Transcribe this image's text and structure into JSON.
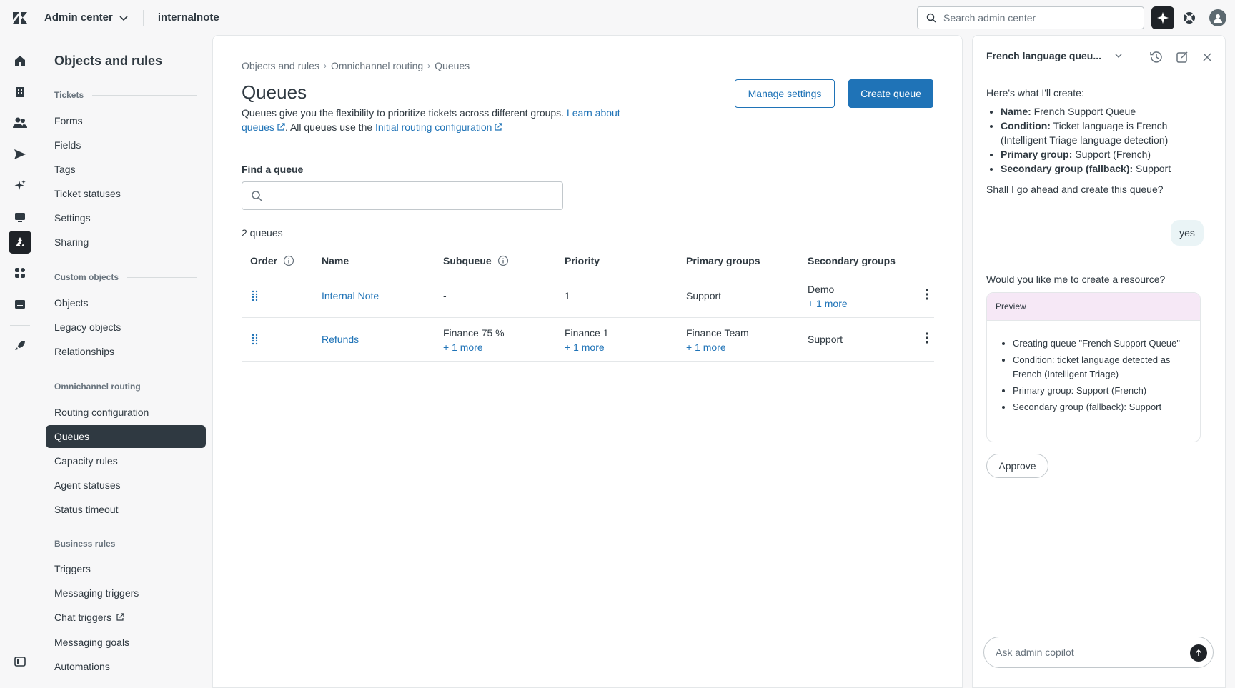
{
  "topbar": {
    "product": "Admin center",
    "account": "internalnote",
    "search_placeholder": "Search admin center"
  },
  "sidenav": {
    "title": "Objects and rules",
    "sections": [
      {
        "label": "Tickets",
        "items": [
          "Forms",
          "Fields",
          "Tags",
          "Ticket statuses",
          "Settings",
          "Sharing"
        ]
      },
      {
        "label": "Custom objects",
        "items": [
          "Objects",
          "Legacy objects",
          "Relationships"
        ]
      },
      {
        "label": "Omnichannel routing",
        "items": [
          "Routing configuration",
          "Queues",
          "Capacity rules",
          "Agent statuses",
          "Status timeout"
        ]
      },
      {
        "label": "Business rules",
        "items": [
          "Triggers",
          "Messaging triggers",
          "Chat triggers",
          "Messaging goals",
          "Automations"
        ]
      }
    ],
    "active_item": "Queues"
  },
  "main": {
    "breadcrumbs": [
      "Objects and rules",
      "Omnichannel routing",
      "Queues"
    ],
    "title": "Queues",
    "desc_text_1": "Queues give you the flexibility to prioritize tickets across different groups. ",
    "desc_link_1": "Learn about queues",
    "desc_text_2": ". All queues use the ",
    "desc_link_2": "Initial routing configuration",
    "manage_settings": "Manage settings",
    "create_queue": "Create queue",
    "find_label": "Find a queue",
    "count": "2 queues",
    "columns": [
      "Order",
      "Name",
      "Subqueue",
      "Priority",
      "Primary groups",
      "Secondary groups"
    ],
    "rows": [
      {
        "name": "Internal Note",
        "subqueue": "-",
        "subqueue_more": "",
        "priority": "1",
        "priority_more": "",
        "primary": "Support",
        "primary_more": "",
        "secondary": "Demo",
        "secondary_more": "+ 1 more"
      },
      {
        "name": "Refunds",
        "subqueue": "Finance 75 %",
        "subqueue_more": "+ 1 more",
        "priority": "Finance 1",
        "priority_more": "+ 1 more",
        "primary": "Finance Team",
        "primary_more": "+ 1 more",
        "secondary": "Support",
        "secondary_more": ""
      }
    ]
  },
  "copilot": {
    "title": "French language queu...",
    "intro": "Here's what I'll create:",
    "list": [
      {
        "key": "Name:",
        "value": " French Support Queue"
      },
      {
        "key": "Condition:",
        "value": " Ticket language is French (Intelligent Triage language detection)"
      },
      {
        "key": "Primary group:",
        "value": " Support (French)"
      },
      {
        "key": "Secondary group (fallback):",
        "value": " Support"
      }
    ],
    "question": "Shall I go ahead and create this queue?",
    "user_reply": "yes",
    "question2": "Would you like me to create a resource?",
    "preview_label": "Preview",
    "preview_items": [
      "Creating queue \"French Support Queue\"",
      "Condition: ticket language detected as French (Intelligent Triage)",
      "Primary group: Support (French)",
      "Secondary group (fallback): Support"
    ],
    "approve": "Approve",
    "input_placeholder": "Ask admin copilot"
  }
}
